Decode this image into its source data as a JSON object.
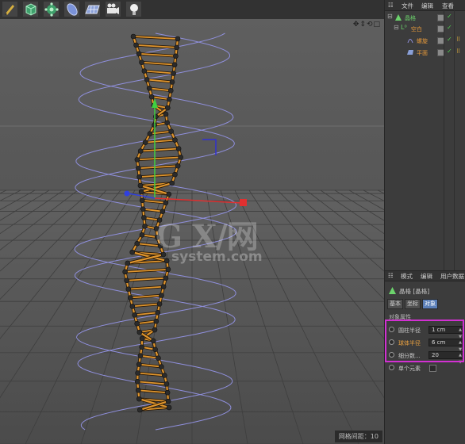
{
  "toolbar": {
    "tools": [
      "pen-tool-icon",
      "cube-icon",
      "gear-nurbs-icon",
      "deformer-icon",
      "plane-grid-icon",
      "camera-icon",
      "light-icon"
    ]
  },
  "viewport": {
    "status_text": "网格间距：10",
    "watermark": {
      "big": "G X/网",
      "small": "system.com"
    }
  },
  "object_manager": {
    "menu": [
      "文件",
      "编辑",
      "查看"
    ],
    "objects": [
      {
        "name": "晶格",
        "indent": 0,
        "color": "#6cd36c"
      },
      {
        "name": "空白",
        "indent": 1,
        "color": "#e89a3a"
      },
      {
        "name": "螺旋",
        "indent": 2,
        "color": "#e89a3a"
      },
      {
        "name": "平面",
        "indent": 2,
        "color": "#e89a3a"
      }
    ]
  },
  "attribute_manager": {
    "menu": [
      "模式",
      "编辑",
      "用户数据"
    ],
    "object_title": "晶格 [晶格]",
    "tabs": [
      "基本",
      "坐标",
      "对象"
    ],
    "active_tab": 2,
    "section": "对象属性",
    "params": [
      {
        "label": "圆柱半径",
        "value": "1 cm",
        "highlight": false
      },
      {
        "label": "球体半径",
        "value": "6 cm",
        "highlight": true
      },
      {
        "label": "细分数...",
        "value": "20",
        "highlight": false
      }
    ],
    "single_element_label": "单个元素"
  },
  "colors": {
    "accent_highlight": "#d230d2",
    "lattice": "#e0962e",
    "spline": "#8f8fdc"
  }
}
